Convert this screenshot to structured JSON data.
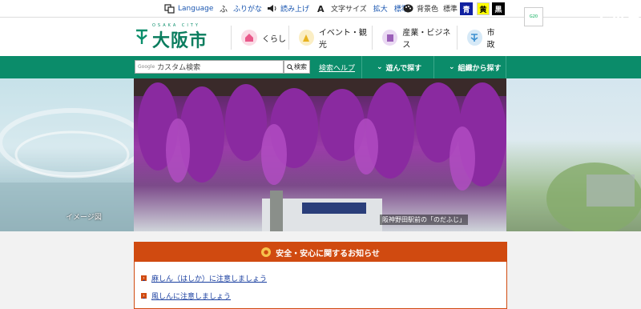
{
  "utility": {
    "language": "Language",
    "furigana": "ふりがな",
    "read_aloud": "読み上げ",
    "text_size_label": "文字サイズ",
    "text_size_enlarge": "拡大",
    "text_size_standard": "標準",
    "bg_color_label": "背景色",
    "bg_color_standard": "標準",
    "bg_blue": "青",
    "bg_yellow": "黄",
    "bg_black": "黒"
  },
  "header": {
    "logo_en": "OSAKA CITY",
    "logo_jp": "大阪市",
    "nav": [
      {
        "label": "くらし",
        "color": "#e9598a"
      },
      {
        "label": "イベント・観光",
        "color": "#e8b321"
      },
      {
        "label": "産業・ビジネス",
        "color": "#9b5fb8"
      },
      {
        "label": "市政",
        "color": "#3a8fd0"
      }
    ]
  },
  "searchbar": {
    "google_label": "Google",
    "placeholder": "カスタム検索",
    "search_button": "検索",
    "help_link": "検索ヘルプ",
    "tab_choose": "遊んで探す",
    "tab_org": "組織から探す"
  },
  "hero": {
    "left_caption": "イメージ図",
    "main_caption": "阪神野田駅前の「のだふじ」",
    "right_text": "G20 大"
  },
  "notice": {
    "title": "安全・安心に関するお知らせ",
    "items": [
      "麻しん（はしか）に注意しましょう",
      "風しんに注意しましょう"
    ]
  },
  "colors": {
    "brand_green": "#0b8c6a",
    "notice_orange": "#d04a10"
  }
}
